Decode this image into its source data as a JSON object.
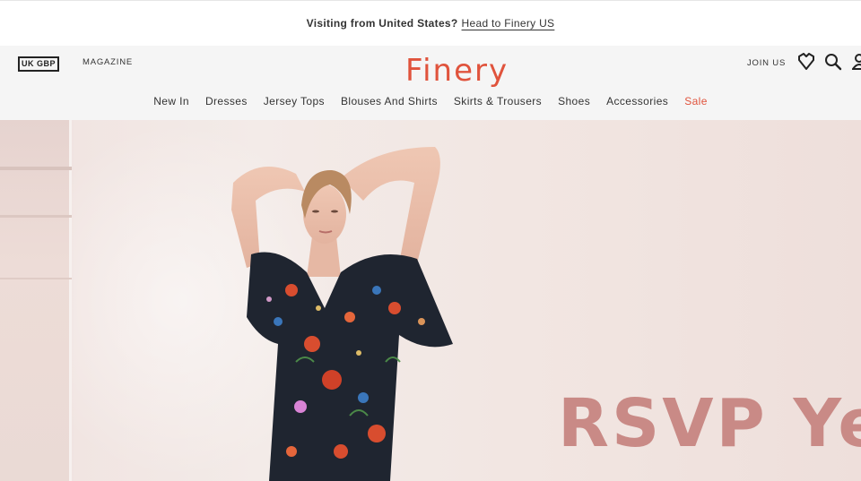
{
  "geo_banner": {
    "visiting_text": "Visiting from United States?",
    "link_text": "Head to Finery US"
  },
  "header": {
    "currency_label": "UK GBP",
    "magazine_label": "MAGAZINE",
    "logo_text": "Finery",
    "join_label": "JOIN US",
    "icons": [
      "heart-icon",
      "search-icon",
      "user-icon"
    ]
  },
  "nav": {
    "items": [
      {
        "label": "New In"
      },
      {
        "label": "Dresses"
      },
      {
        "label": "Jersey Tops"
      },
      {
        "label": "Blouses And Shirts"
      },
      {
        "label": "Skirts & Trousers"
      },
      {
        "label": "Shoes"
      },
      {
        "label": "Accessories"
      },
      {
        "label": "Sale"
      }
    ]
  },
  "hero": {
    "headline": "RSVP Yes"
  },
  "colors": {
    "brand_red": "#e0533c",
    "headline_pink": "#c98a86",
    "header_bg": "#f5f5f5"
  }
}
